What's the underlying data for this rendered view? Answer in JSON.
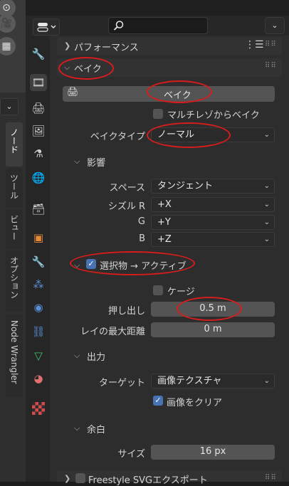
{
  "left_tabs": [
    "ノード",
    "ツール",
    "ビュー",
    "オプション",
    "Node Wrangler"
  ],
  "header": {
    "search_placeholder": ""
  },
  "sections": {
    "performance": {
      "label": "パフォーマンス"
    },
    "bake": {
      "label": "ベイク",
      "bake_button": "ベイク",
      "multires_checkbox": "マルチレゾからベイク",
      "bake_type_label": "ベイクタイプ",
      "bake_type_value": "ノーマル",
      "influence": {
        "label": "影響",
        "space_label": "スペース",
        "space_value": "タンジェント",
        "swizzle_r_label": "シズル R",
        "swizzle_r_value": "+X",
        "g_label": "G",
        "g_value": "+Y",
        "b_label": "B",
        "b_value": "+Z"
      },
      "selected_to_active": {
        "label": "選択物 → アクティブ",
        "checked": true,
        "cage_label": "ケージ",
        "extrusion_label": "押し出し",
        "extrusion_value": "0.5 m",
        "max_ray_label": "レイの最大距離",
        "max_ray_value": "0 m"
      },
      "output": {
        "label": "出力",
        "target_label": "ターゲット",
        "target_value": "画像テクスチャ",
        "clear_image_label": "画像をクリア",
        "clear_image_checked": true
      },
      "margin": {
        "label": "余白",
        "size_label": "サイズ",
        "size_value": "16 px"
      }
    },
    "freestyle": {
      "label": "Freestyle SVGエクスポート"
    }
  },
  "colors": {
    "annotation": "#d71c1c",
    "checkbox_on": "#4772b3"
  }
}
